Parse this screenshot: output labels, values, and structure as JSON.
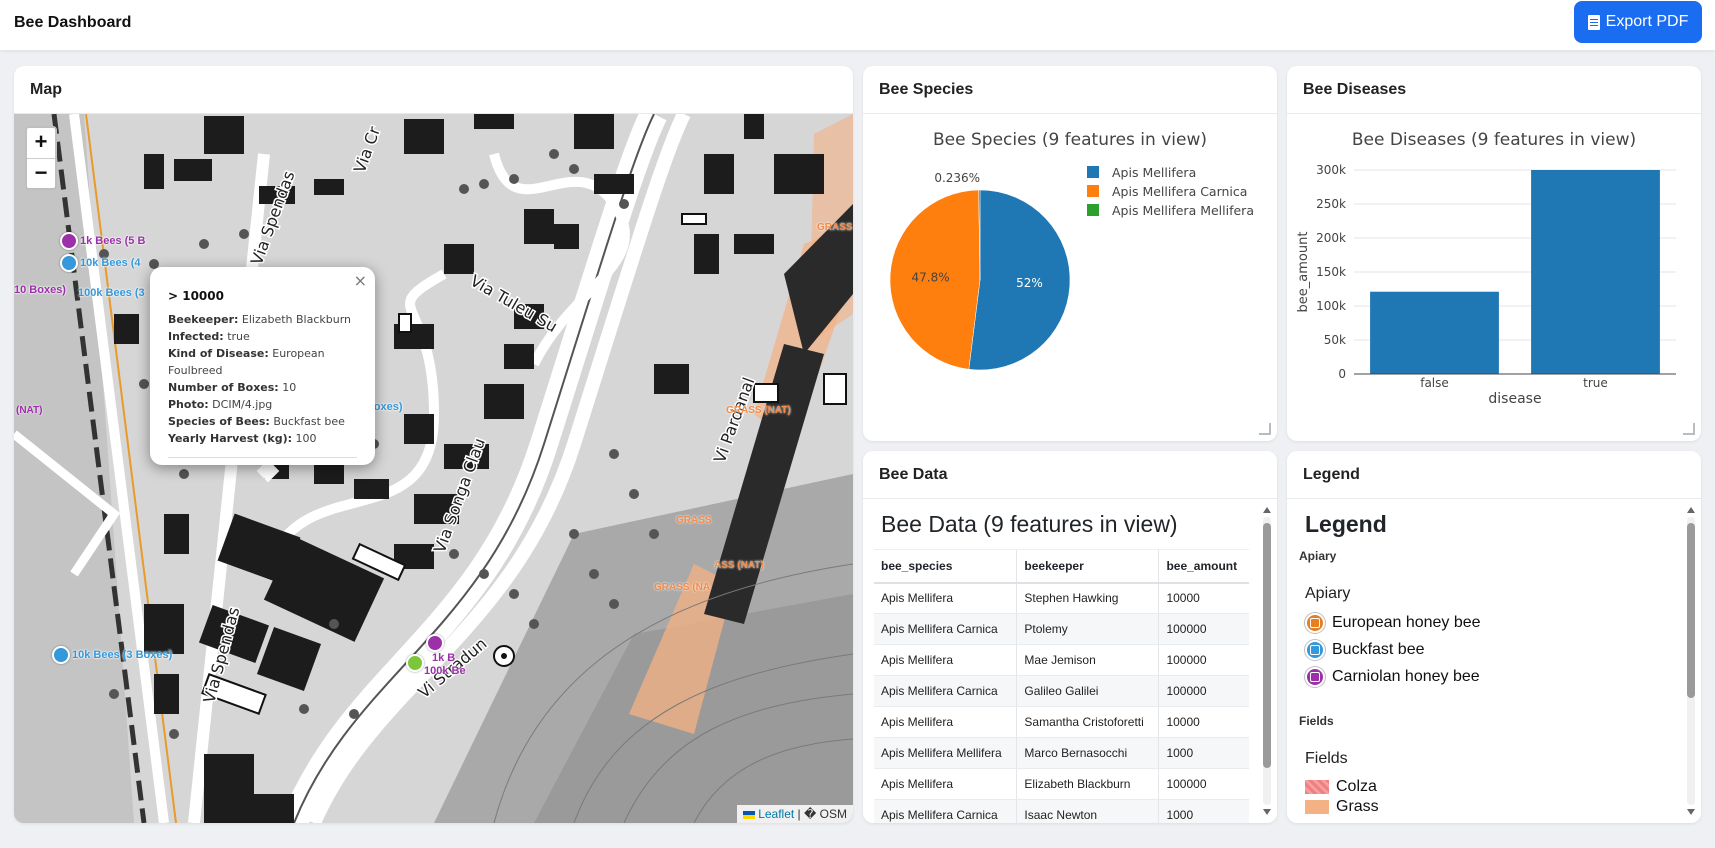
{
  "app": {
    "title": "Bee Dashboard",
    "export_label": "Export PDF"
  },
  "colors": {
    "accent": "#1a6cf0",
    "apis_mellifera": "#1f77b4",
    "apis_mellifera_carnica": "#ff7f0e",
    "apis_mellifera_mellifera": "#2ca02c",
    "european_honey_bee": "#e67e22",
    "buckfast_bee": "#3498db",
    "carniolan_honey_bee": "#9b30a8",
    "colza": "#f08080",
    "grass": "#f4b183"
  },
  "map": {
    "title": "Map",
    "zoom_in": "+",
    "zoom_out": "−",
    "attribution_leaflet": "Leaflet",
    "attribution_sep": " | ",
    "attribution_osm": "� OSM",
    "markers": [
      {
        "label": "1k Bees (5 B",
        "color": "#9b30a8"
      },
      {
        "label": "10k Bees (4",
        "color": "#3498db"
      },
      {
        "label": "10 Boxes)",
        "color": "#9b30a8"
      },
      {
        "label": "100k Bees (3",
        "color": "#3498db"
      },
      {
        "label": "100k Bees (10 Boxes)",
        "color": "#3498db"
      },
      {
        "label": "10k Bees (3 Boxes)",
        "color": "#3498db"
      },
      {
        "label": "1k B",
        "color": "#9b30a8"
      },
      {
        "label": "100k Be",
        "color": "#9b30a8"
      }
    ],
    "fields": [
      "GRASS",
      "GRASS (NAT)",
      "GRASS",
      "ASS (NAT)",
      "GRASS (NA",
      "(NAT)"
    ],
    "streets": [
      "Via Spendas",
      "Via Cr",
      "Via Tuleu Su",
      "Via Songa Clau",
      "Vi Pardanal",
      "Via Spendas",
      "Vi Stradun"
    ],
    "popup": {
      "title": "> 10000",
      "close": "×",
      "rows": [
        {
          "key": "Beekeeper:",
          "value": "Elizabeth Blackburn"
        },
        {
          "key": "Infected:",
          "value": "true"
        },
        {
          "key": "Kind of Disease:",
          "value": "European Foulbreed"
        },
        {
          "key": "Number of Boxes:",
          "value": "10"
        },
        {
          "key": "Photo:",
          "value": "DCIM/4.jpg"
        },
        {
          "key": "Species of Bees:",
          "value": "Buckfast bee"
        },
        {
          "key": "Yearly Harvest (kg):",
          "value": "100"
        }
      ]
    }
  },
  "species": {
    "card_title": "Bee Species",
    "chart_data": {
      "type": "pie",
      "title": "Bee Species (9 features in view)",
      "series": [
        {
          "name": "Apis Mellifera",
          "value": 52,
          "label": "52%"
        },
        {
          "name": "Apis Mellifera Carnica",
          "value": 47.8,
          "label": "47.8%"
        },
        {
          "name": "Apis Mellifera Mellifera",
          "value": 0.236,
          "label": "0.236%"
        }
      ],
      "legend_position": "top-right"
    }
  },
  "diseases": {
    "card_title": "Bee Diseases",
    "chart_data": {
      "type": "bar",
      "title": "Bee Diseases (9 features in view)",
      "categories": [
        "false",
        "true"
      ],
      "values": [
        121000,
        300000
      ],
      "xlabel": "disease",
      "ylabel": "bee_amount",
      "ylim": [
        0,
        300000
      ],
      "yticks": [
        0,
        50000,
        100000,
        150000,
        200000,
        250000,
        300000
      ],
      "ytick_labels": [
        "0",
        "50k",
        "100k",
        "150k",
        "200k",
        "250k",
        "300k"
      ],
      "grid": true
    }
  },
  "data_table": {
    "card_title": "Bee Data",
    "heading": "Bee Data (9 features in view)",
    "columns": [
      "bee_species",
      "beekeeper",
      "bee_amount"
    ],
    "rows": [
      [
        "Apis Mellifera",
        "Stephen Hawking",
        "10000"
      ],
      [
        "Apis Mellifera Carnica",
        "Ptolemy",
        "100000"
      ],
      [
        "Apis Mellifera",
        "Mae Jemison",
        "100000"
      ],
      [
        "Apis Mellifera Carnica",
        "Galileo Galilei",
        "100000"
      ],
      [
        "Apis Mellifera",
        "Samantha Cristoforetti",
        "10000"
      ],
      [
        "Apis Mellifera Mellifera",
        "Marco Bernasocchi",
        "1000"
      ],
      [
        "Apis Mellifera",
        "Elizabeth Blackburn",
        "100000"
      ],
      [
        "Apis Mellifera Carnica",
        "Isaac Newton",
        "1000"
      ]
    ]
  },
  "legend": {
    "card_title": "Legend",
    "heading": "Legend",
    "apiary_small": "Apiary",
    "apiary_title": "Apiary",
    "apiary_items": [
      {
        "label": "European honey bee",
        "color": "#e67e22"
      },
      {
        "label": "Buckfast bee",
        "color": "#3498db"
      },
      {
        "label": "Carniolan honey bee",
        "color": "#9b30a8"
      }
    ],
    "fields_small": "Fields",
    "fields_title": "Fields",
    "field_items": [
      {
        "label": "Colza",
        "color": "#f08080"
      },
      {
        "label": "Grass",
        "color": "#f4b183"
      }
    ]
  }
}
